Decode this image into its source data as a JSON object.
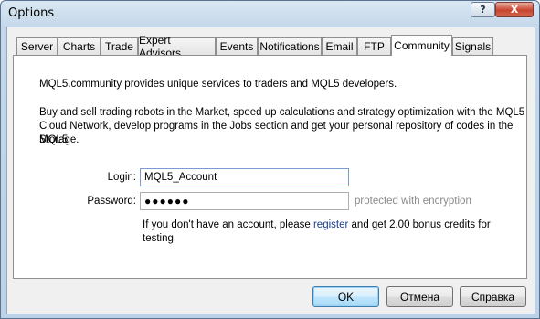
{
  "window": {
    "title": "Options",
    "help_glyph": "?",
    "close_glyph": "X"
  },
  "tabs": [
    {
      "label": "Server"
    },
    {
      "label": "Charts"
    },
    {
      "label": "Trade"
    },
    {
      "label": "Expert Advisors"
    },
    {
      "label": "Events"
    },
    {
      "label": "Notifications"
    },
    {
      "label": "Email"
    },
    {
      "label": "FTP"
    },
    {
      "label": "Community",
      "active": true
    },
    {
      "label": "Signals"
    }
  ],
  "community": {
    "intro": "MQL5.community provides unique services to traders and MQL5 developers.",
    "desc_line1": "Buy and sell trading robots in the Market, speed up calculations and strategy optimization with the MQL5",
    "desc_line2": "Cloud Network, develop programs in the Jobs section and get your personal repository of codes in the MQL5",
    "desc_line3": "Storage.",
    "login_label": "Login:",
    "login_value": "MQL5_Account",
    "password_label": "Password:",
    "password_value": "●●●●●●",
    "password_hint": "protected with encryption",
    "account_prefix": "If you don't have an account, please ",
    "register_link": "register",
    "account_suffix": " and get 2.00 bonus credits for",
    "account_line2": "testing."
  },
  "buttons": {
    "ok": "OK",
    "cancel": "Отмена",
    "help": "Справка"
  }
}
